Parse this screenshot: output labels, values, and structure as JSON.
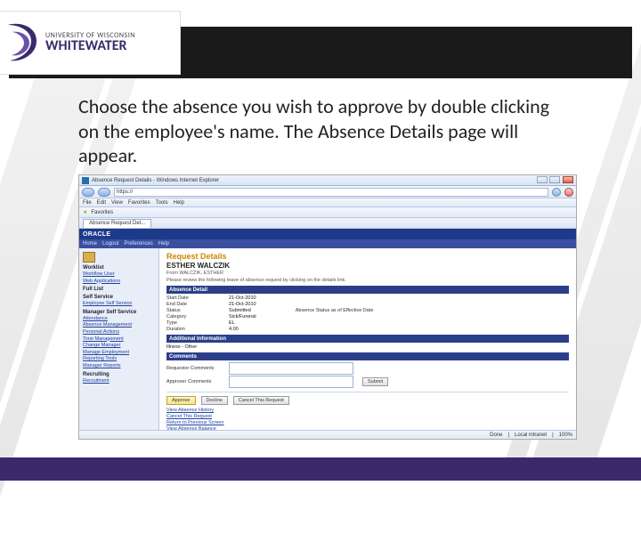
{
  "logo": {
    "line1": "UNIVERSITY OF WISCONSIN",
    "line2": "WHITEWATER"
  },
  "instruction": "Choose the absence you wish to approve by double clicking on the employee's name.  The Absence Details page will appear.",
  "browser": {
    "title": "Absence Request Details - Windows Internet Explorer",
    "url": "https://",
    "menus": [
      "File",
      "Edit",
      "View",
      "Favorites",
      "Tools",
      "Help"
    ],
    "favorites_label": "Favorites",
    "tab": "Absence Request Det...",
    "status_done": "Done",
    "status_zone": "Local intranet",
    "status_zoom": "100%"
  },
  "oracle": {
    "brand": "ORACLE",
    "nav_tabs": [
      "Home",
      "Logout",
      "Preferences",
      "Help"
    ]
  },
  "sidebar": {
    "heading1": "Worklist",
    "links1": [
      "Workflow User",
      "Web Applications"
    ],
    "heading2": "Full List",
    "heading3": "Self Service",
    "links3": [
      "Employee Self Service"
    ],
    "heading4": "Manager Self Service",
    "links4": [
      "Attendance",
      "Absence Management",
      "Personal Actions",
      "Time Management",
      "Change Manager",
      "Manage Employment",
      "Reporting Tools",
      "Manager Reports"
    ],
    "heading5": "Recruiting",
    "links5": [
      "Recruitment"
    ]
  },
  "page": {
    "title": "Request Details",
    "employee": "ESTHER WALCZIK",
    "meta_from": "From WALCZIK, ESTHER",
    "meta_note": "Please review the following leave of absence request by clicking on the details link."
  },
  "details": {
    "section": "Absence Detail",
    "start_date_label": "Start Date",
    "start_date": "21-Oct-2010",
    "end_date_label": "End Date",
    "end_date": "21-Oct-2010",
    "status_label": "Status",
    "status": "Submitted",
    "status_extra_label": "Absence Status as of Effective Date",
    "category_label": "Category",
    "category": "Sick/Funeral",
    "type_label": "Type",
    "type": "EL",
    "duration_label": "Duration",
    "duration": "4.00"
  },
  "info": {
    "section": "Additional Information",
    "value": "Illness - Other"
  },
  "comments": {
    "section": "Comments",
    "requestor_label": "Requestor Comments",
    "approver_label": "Approver Comments"
  },
  "actions": {
    "approve": "Approve",
    "reject_label": "Decline",
    "submit": "Submit",
    "view_history": "View Absence History",
    "cancel": "Cancel This Request",
    "return": "Return to Previous Screen",
    "view_balance": "View Absence Balance"
  }
}
